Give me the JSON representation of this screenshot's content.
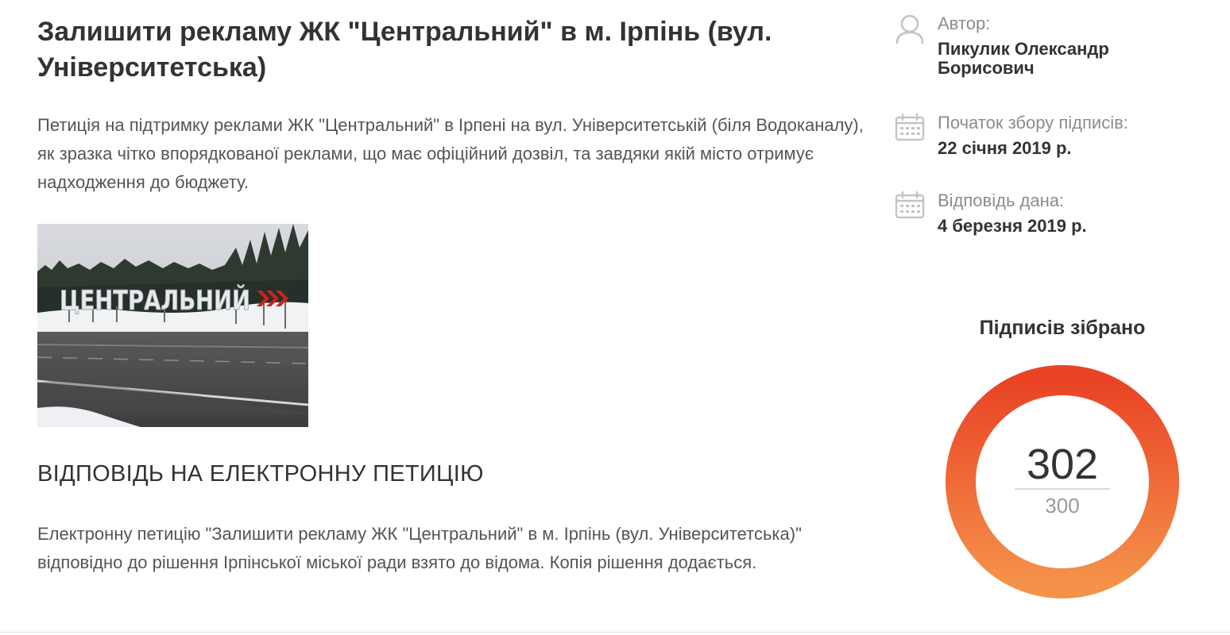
{
  "petition": {
    "title": "Залишити рекламу ЖК \"Центральний\" в м. Ірпінь (вул. Університетська)",
    "description": "Петиція на підтримку реклами ЖК \"Центральний\" в Ірпені на вул. Університетській (біля Водоканалу), як зразка чітко впорядкованої реклами, що має офіційний дозвіл, та завдяки якій місто отримує надходження до бюджету.",
    "image": {
      "sign_text": "ЦЕНТРАЛЬНИЙ"
    }
  },
  "answer": {
    "heading": "ВІДПОВІДЬ НА ЕЛЕКТРОННУ ПЕТИЦІЮ",
    "text": "Електронну петицію \"Залишити рекламу ЖК \"Центральний\" в м. Ірпінь (вул. Університетська)\" відповідно до рішення Ірпінської міської ради взято до відома. Копія рішення додається."
  },
  "sidebar": {
    "author": {
      "label": "Автор:",
      "value": "Пикулик Олександр Борисович",
      "icon": "user-icon"
    },
    "start": {
      "label": "Початок збору підписів:",
      "value": "22 січня 2019 р.",
      "icon": "calendar-icon"
    },
    "answered": {
      "label": "Відповідь дана:",
      "value": "4 березня 2019 р.",
      "icon": "calendar-icon"
    }
  },
  "signatures": {
    "title": "Підписів зібрано",
    "count": "302",
    "target": "300",
    "progress": 1.0,
    "colors": {
      "start": "#f4924a",
      "end": "#ea4326"
    }
  },
  "colors": {
    "text_dark": "#333333",
    "text_body": "#555555",
    "text_muted": "#8c8c8c",
    "icon": "#c4c4c4"
  }
}
